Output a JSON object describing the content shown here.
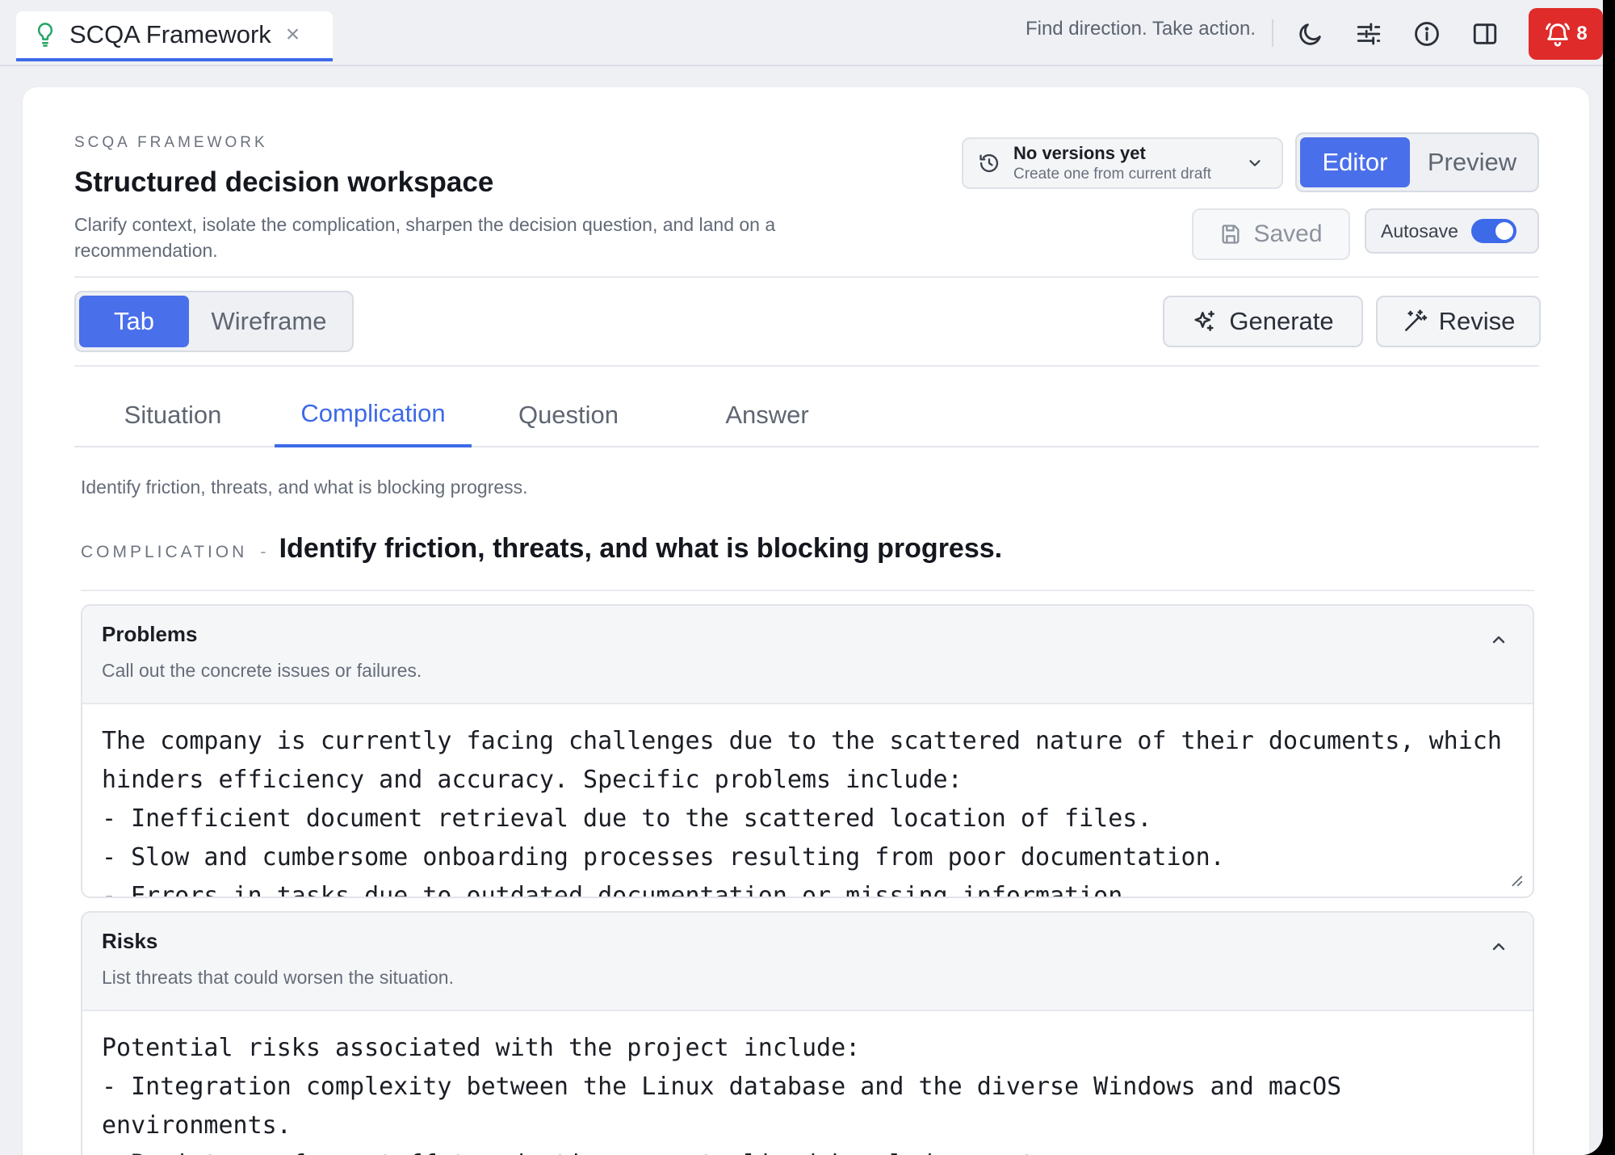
{
  "tab": {
    "title": "SCQA Framework",
    "close": "×"
  },
  "topbar": {
    "tagline": "Find direction. Take action.",
    "icons": [
      "moon-icon",
      "sliders-icon",
      "info-icon",
      "sidebar-icon"
    ],
    "alert_count": "8"
  },
  "header": {
    "eyebrow": "SCQA FRAMEWORK",
    "title": "Structured decision workspace",
    "description": "Clarify context, isolate the complication, sharpen the decision question, and land on a recommendation."
  },
  "versions": {
    "main": "No versions yet",
    "sub": "Create one from current draft"
  },
  "mode": {
    "options": [
      "Editor",
      "Preview"
    ],
    "active": "Editor"
  },
  "saved_label": "Saved",
  "autosave_label": "Autosave",
  "view": {
    "options": [
      "Tab",
      "Wireframe"
    ],
    "active": "Tab"
  },
  "actions": {
    "generate": "Generate",
    "revise": "Revise"
  },
  "tabs": [
    "Situation",
    "Complication",
    "Question",
    "Answer"
  ],
  "active_tab": "Complication",
  "tab_hint": "Identify friction, threats, and what is blocking progress.",
  "section": {
    "label": "COMPLICATION",
    "dash": "-",
    "heading": "Identify friction, threats, and what is blocking progress."
  },
  "panels": [
    {
      "title": "Problems",
      "subtitle": "Call out the concrete issues or failures.",
      "body": "The company is currently facing challenges due to the scattered nature of their documents, which hinders efficiency and accuracy. Specific problems include:\n- Inefficient document retrieval due to the scattered location of files.\n- Slow and cumbersome onboarding processes resulting from poor documentation.\n- Errors in tasks due to outdated documentation or missing information."
    },
    {
      "title": "Risks",
      "subtitle": "List threats that could worsen the situation.",
      "body": "Potential risks associated with the project include:\n- Integration complexity between the Linux database and the diverse Windows and macOS environments.\n- Resistance from staff to adopting a centralized knowledge system."
    }
  ],
  "colors": {
    "accent": "#3d6ae8",
    "alert": "#e02b2b",
    "bulb": "#27a567"
  }
}
